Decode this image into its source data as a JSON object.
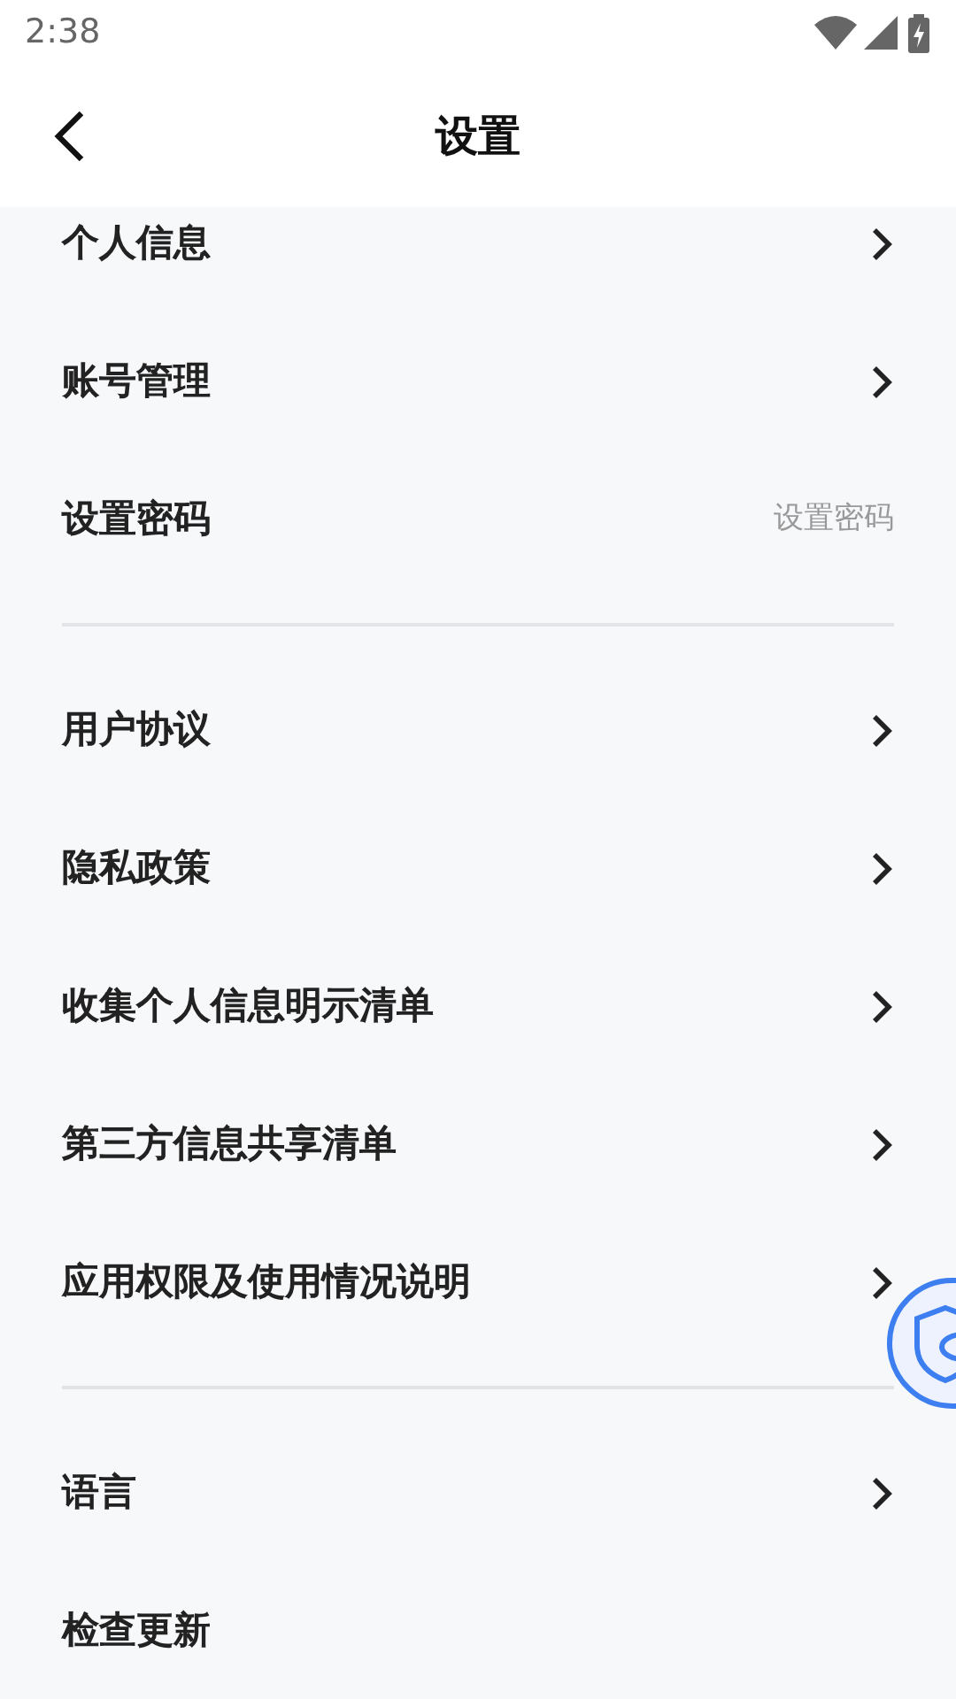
{
  "status_bar": {
    "time": "2:38"
  },
  "header": {
    "title": "设置"
  },
  "sections": [
    {
      "items": [
        {
          "label": "个人信息",
          "kind": "link"
        },
        {
          "label": "账号管理",
          "kind": "link"
        },
        {
          "label": "设置密码",
          "kind": "value",
          "value": "设置密码"
        }
      ]
    },
    {
      "items": [
        {
          "label": "用户协议",
          "kind": "link"
        },
        {
          "label": "隐私政策",
          "kind": "link"
        },
        {
          "label": "收集个人信息明示清单",
          "kind": "link"
        },
        {
          "label": "第三方信息共享清单",
          "kind": "link"
        },
        {
          "label": "应用权限及使用情况说明",
          "kind": "link"
        }
      ]
    },
    {
      "items": [
        {
          "label": "语言",
          "kind": "link"
        },
        {
          "label": "检查更新",
          "kind": "plain"
        }
      ]
    }
  ]
}
